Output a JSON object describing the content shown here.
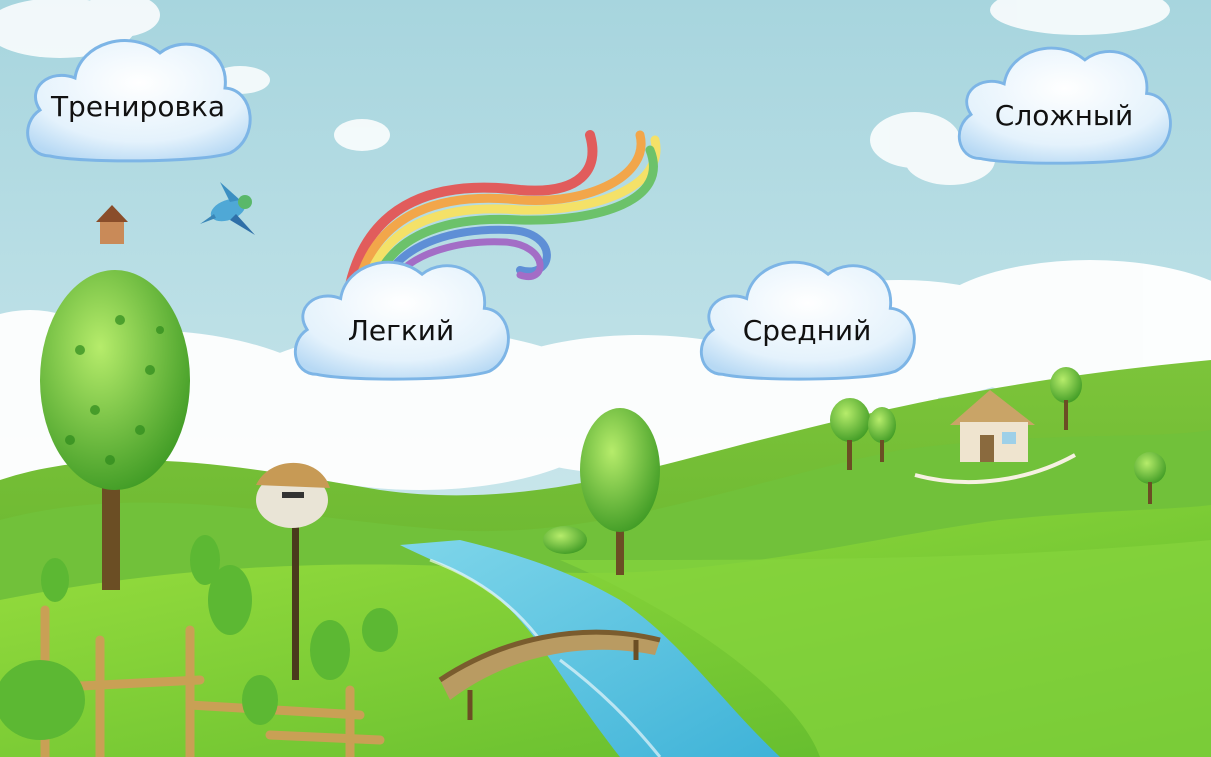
{
  "menu": {
    "training_label": "Тренировка",
    "hard_label": "Сложный",
    "easy_label": "Легкий",
    "medium_label": "Средний"
  },
  "colors": {
    "sky_top": "#a9d6df",
    "sky_bottom": "#d9eff2",
    "grass_light": "#8fd23a",
    "grass_dark": "#3f9a1e",
    "river": "#5ec9e3",
    "cloud_fill": "#e7f4fd",
    "cloud_edge": "#7fb8e8"
  }
}
